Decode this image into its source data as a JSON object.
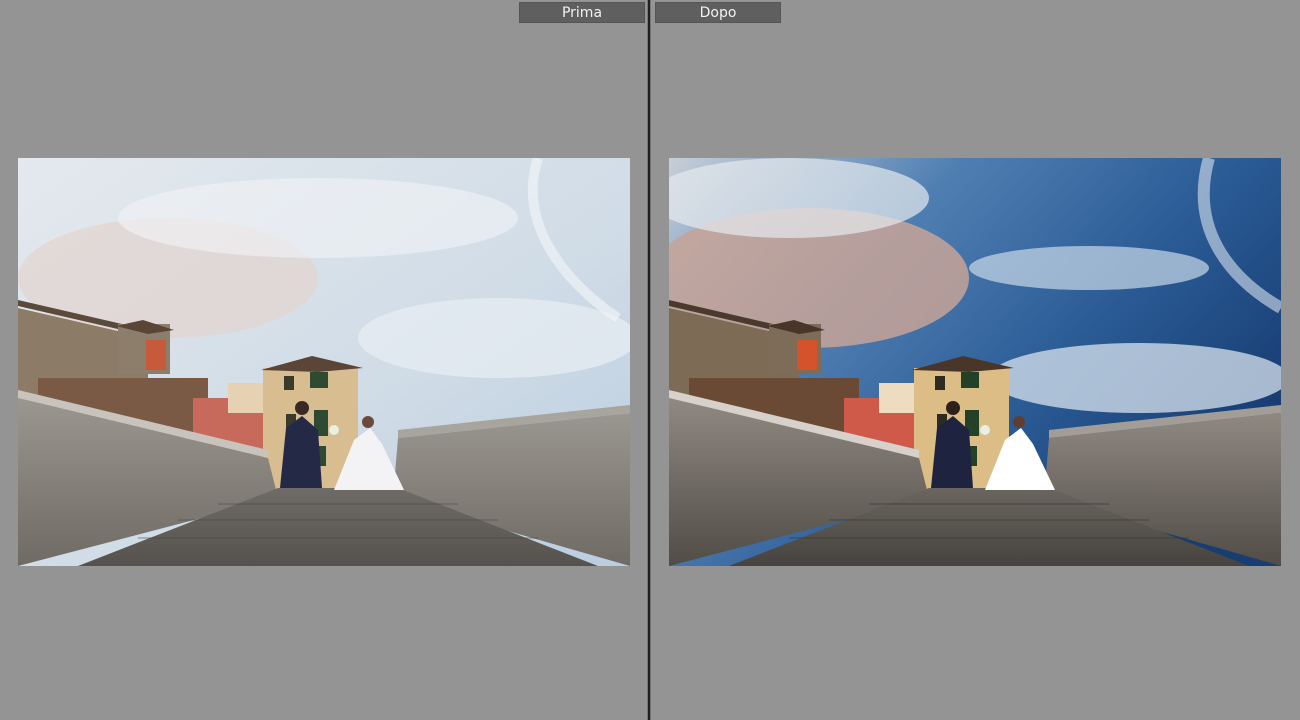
{
  "compare": {
    "before_label": "Prima",
    "after_label": "Dopo"
  },
  "colors": {
    "workspace_bg": "#949494",
    "label_bg": "#5f5f5f",
    "label_text": "#f2f2f2",
    "divider": "#1f1f1f"
  }
}
